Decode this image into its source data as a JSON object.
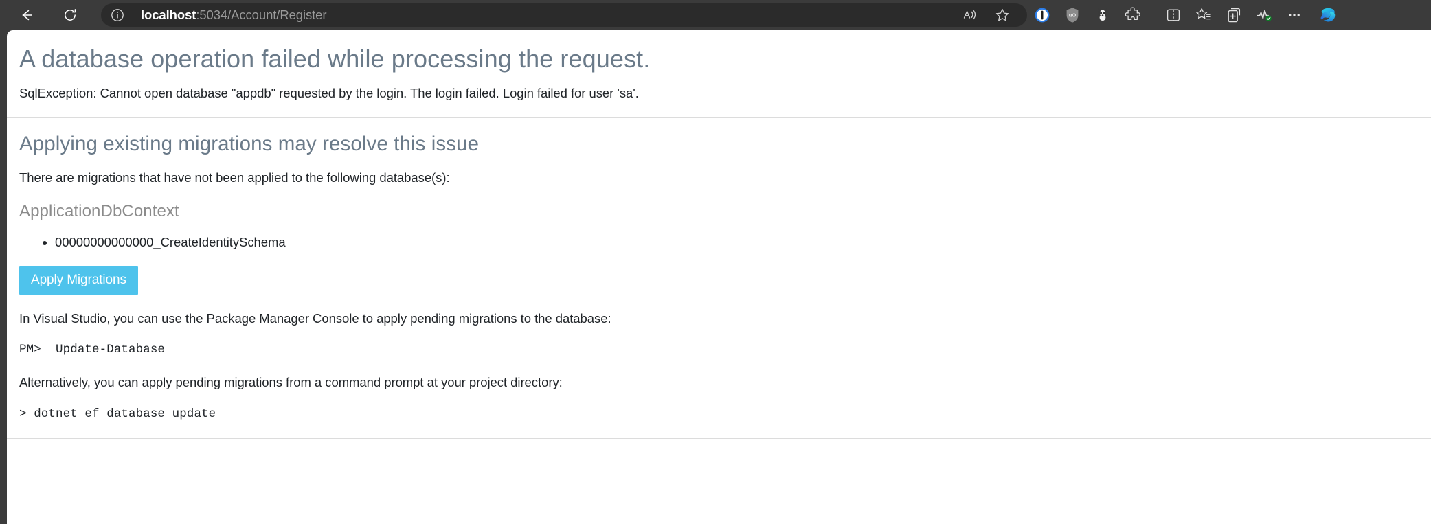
{
  "browser": {
    "back_label": "Back",
    "reload_label": "Refresh",
    "site_info_label": "View site information",
    "url": {
      "host": "localhost",
      "rest": ":5034/Account/Register",
      "full": "localhost:5034/Account/Register"
    },
    "read_aloud_label": "Read this page aloud",
    "favorite_label": "Add this page to favorites",
    "toolbar_items": [
      {
        "name": "1password-icon",
        "label": "1Password"
      },
      {
        "name": "ublock-origin-icon",
        "label": "uBlock Origin"
      },
      {
        "name": "privacy-badger-icon",
        "label": "Privacy Badger"
      },
      {
        "name": "extensions-icon",
        "label": "Extensions"
      },
      {
        "name": "split-screen-icon",
        "label": "Split screen"
      },
      {
        "name": "favorites-list-icon",
        "label": "Favorites"
      },
      {
        "name": "collections-icon",
        "label": "Collections"
      },
      {
        "name": "browser-essentials-icon",
        "label": "Browser essentials"
      },
      {
        "name": "settings-and-more-icon",
        "label": "Settings and more"
      },
      {
        "name": "copilot-icon",
        "label": "Copilot"
      }
    ],
    "accent_color": "#0f6cbd"
  },
  "error_page": {
    "title": "A database operation failed while processing the request.",
    "exception": "SqlException: Cannot open database \"appdb\" requested by the login. The login failed. Login failed for user 'sa'.",
    "section_heading": "Applying existing migrations may resolve this issue",
    "section_intro": "There are migrations that have not been applied to the following database(s):",
    "context_name": "ApplicationDbContext",
    "migrations": [
      "00000000000000_CreateIdentitySchema"
    ],
    "apply_button_label": "Apply Migrations",
    "visual_studio_note": "In Visual Studio, you can use the Package Manager Console to apply pending migrations to the database:",
    "pm_command": "PM>  Update-Database",
    "alternative_note": "Alternatively, you can apply pending migrations from a command prompt at your project directory:",
    "cli_command": "> dotnet ef database update",
    "button_color": "#4ec3ec",
    "heading_color": "#6a7a89"
  }
}
